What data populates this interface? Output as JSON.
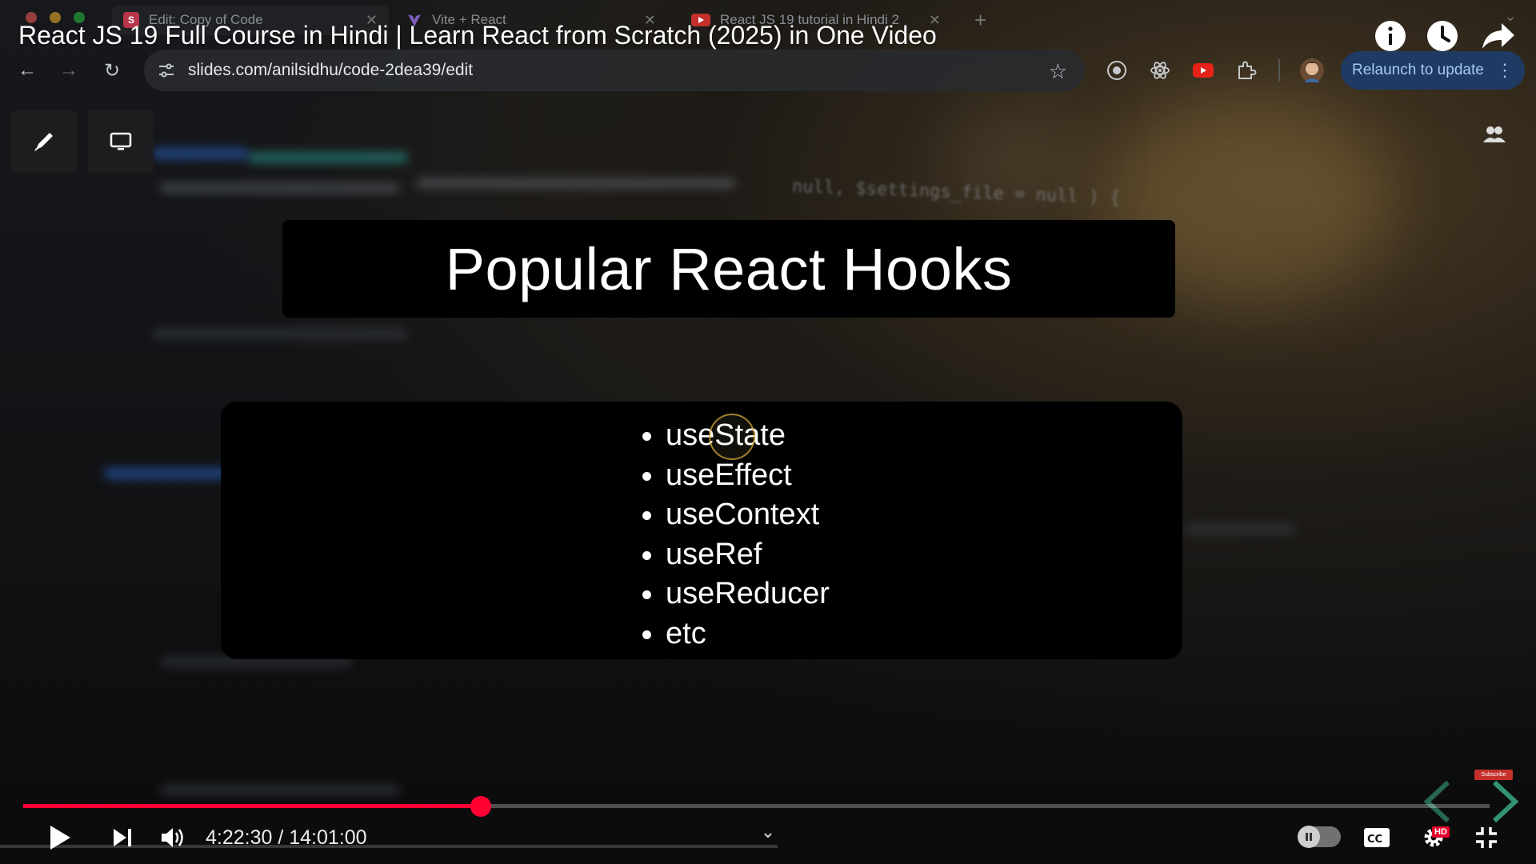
{
  "browser": {
    "tabs": [
      {
        "label": "Edit: Copy of Code",
        "favicon": "slides-icon"
      },
      {
        "label": "Vite + React",
        "favicon": "vite-icon"
      },
      {
        "label": "React JS 19 tutorial in Hindi 2",
        "favicon": "youtube-icon"
      }
    ],
    "url": "slides.com/anilsidhu/code-2dea39/edit",
    "relaunch_label": "Relaunch to update"
  },
  "video": {
    "title": "React JS 19 Full Course in Hindi | Learn React from Scratch (2025) in One Video",
    "time_display": "4:22:30 / 14:01:00",
    "progress_fraction": 0.3122,
    "hd_label": "HD",
    "subscribe_label": "Subscribe"
  },
  "slide": {
    "title": "Popular React Hooks",
    "items": [
      "useState",
      "useEffect",
      "useContext",
      "useRef",
      "useReducer",
      "etc"
    ]
  },
  "colors": {
    "accent_red": "#ff0033",
    "relaunch_bg": "#1f3b63",
    "relaunch_text": "#a8c7fa"
  }
}
